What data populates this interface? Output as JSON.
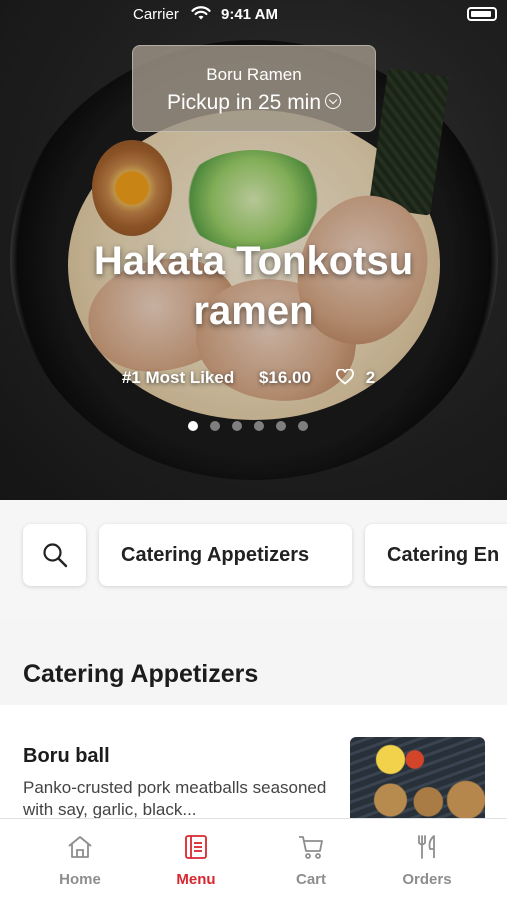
{
  "status_bar": {
    "carrier": "Carrier",
    "time": "9:41 AM"
  },
  "pickup": {
    "restaurant": "Boru Ramen",
    "time_label": "Pickup in 25 min"
  },
  "hero": {
    "title": "Hakata Tonkotsu ramen",
    "rank": "#1 Most Liked",
    "price": "$16.00",
    "likes": "2",
    "slide_count": 6,
    "active_slide": 1
  },
  "categories": {
    "chips": [
      "Catering Appetizers",
      "Catering En"
    ]
  },
  "section": {
    "title": "Catering Appetizers"
  },
  "item": {
    "name": "Boru ball",
    "description": "Panko-crusted pork meatballs seasoned with say, garlic, black..."
  },
  "tabs": [
    {
      "label": "Home",
      "icon": "home-icon",
      "active": false
    },
    {
      "label": "Menu",
      "icon": "menu-icon",
      "active": true
    },
    {
      "label": "Cart",
      "icon": "cart-icon",
      "active": false
    },
    {
      "label": "Orders",
      "icon": "orders-icon",
      "active": false
    }
  ],
  "colors": {
    "accent": "#d8262e",
    "tab_inactive": "#8e8e8e"
  }
}
